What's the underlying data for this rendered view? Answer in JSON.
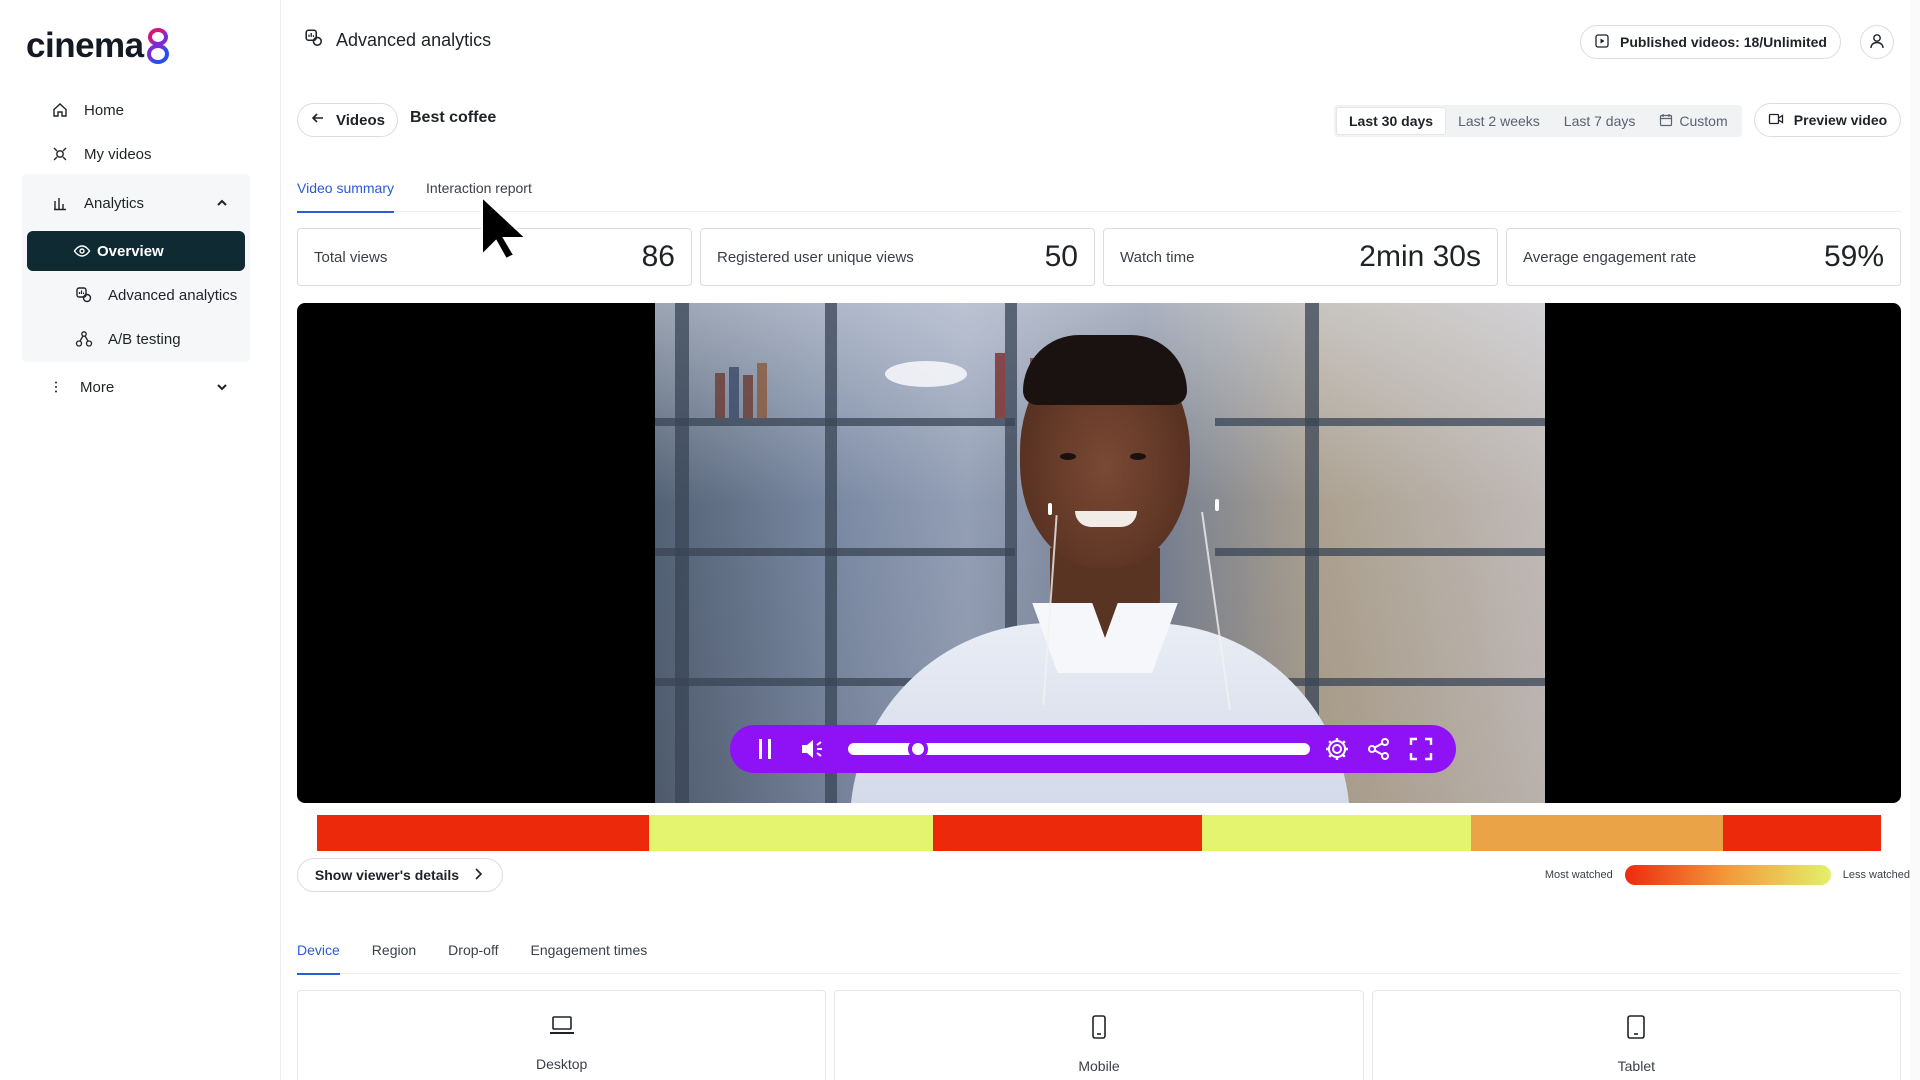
{
  "brand": {
    "name": "cinema",
    "suffix": "8"
  },
  "sidebar": {
    "items": [
      {
        "label": "Home",
        "icon": "home-icon"
      },
      {
        "label": "My videos",
        "icon": "video-reel-icon"
      },
      {
        "label": "Analytics",
        "icon": "bar-chart-icon"
      },
      {
        "label": "Overview",
        "icon": "eye-icon",
        "active": true
      },
      {
        "label": "Advanced analytics",
        "icon": "advanced-analytics-icon"
      },
      {
        "label": "A/B testing",
        "icon": "ab-testing-icon"
      },
      {
        "label": "More",
        "icon": "more-vertical-icon"
      }
    ]
  },
  "header": {
    "title": "Advanced analytics",
    "published": "Published videos: 18/Unlimited"
  },
  "toolbar": {
    "back_label": "Videos",
    "video_title": "Best coffee",
    "ranges": [
      "Last 30 days",
      "Last 2 weeks",
      "Last 7 days",
      "Custom"
    ],
    "selected_range": "Last 30 days",
    "preview_label": "Preview video"
  },
  "tabs": [
    "Video summary",
    "Interaction report"
  ],
  "active_tab": "Video summary",
  "stats": [
    {
      "label": "Total views",
      "value": "86"
    },
    {
      "label": "Registered user unique views",
      "value": "50"
    },
    {
      "label": "Watch time",
      "value": "2min 30s"
    },
    {
      "label": "Average engagement rate",
      "value": "59%"
    }
  ],
  "player": {
    "progress": 0.13
  },
  "heatmap": {
    "segments": [
      {
        "fraction": 0.212,
        "color": "#ec2a0b"
      },
      {
        "fraction": 0.182,
        "color": "#e4f46e"
      },
      {
        "fraction": 0.172,
        "color": "#ec2a0b"
      },
      {
        "fraction": 0.172,
        "color": "#e4f46e"
      },
      {
        "fraction": 0.161,
        "color": "#eba347"
      },
      {
        "fraction": 0.101,
        "color": "#ec2a0b"
      }
    ]
  },
  "viewer_details": {
    "label": "Show viewer's details"
  },
  "legend": {
    "most": "Most watched",
    "less": "Less watched"
  },
  "device_tabs": [
    "Device",
    "Region",
    "Drop-off",
    "Engagement times"
  ],
  "active_device_tab": "Device",
  "devices": [
    {
      "label": "Desktop",
      "icon": "laptop-icon"
    },
    {
      "label": "Mobile",
      "icon": "mobile-icon"
    },
    {
      "label": "Tablet",
      "icon": "tablet-icon"
    }
  ],
  "colors": {
    "accent": "#2c5bd6",
    "nav_active": "#0f2a33",
    "player": "#8f12f6"
  }
}
